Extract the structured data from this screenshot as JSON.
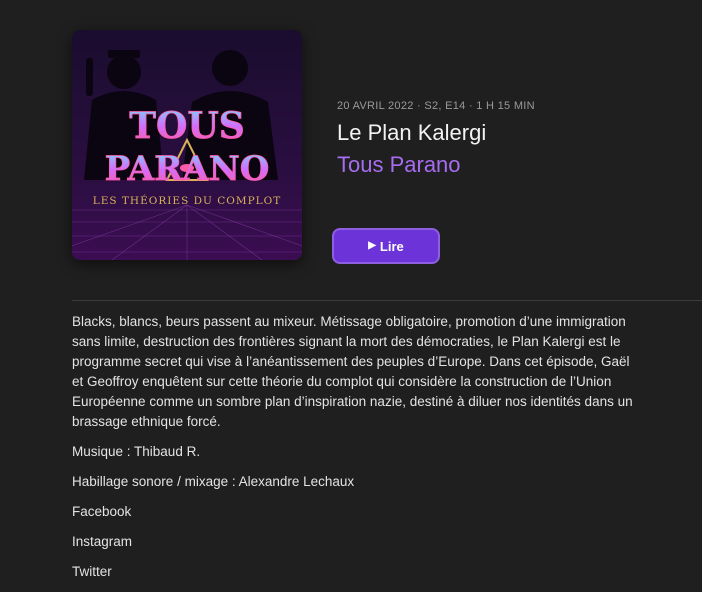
{
  "artwork": {
    "show_name_line1": "TOUS",
    "show_name_line2": "PARANO",
    "tagline": "LES THÉORIES DU COMPLOT",
    "colors": {
      "background_top": "#1a0d2e",
      "background_bottom": "#3b0d52",
      "title_pink": "#ff5aa5",
      "title_cyan": "#6fe3ff",
      "tagline_gold": "#d9b15a"
    }
  },
  "episode": {
    "meta": "20 AVRIL 2022 · S2, E14 · 1 H 15 MIN",
    "title": "Le Plan Kalergi",
    "show": "Tous Parano"
  },
  "play_button": {
    "label": "Lire",
    "icon": "play-icon"
  },
  "description": {
    "summary": "Blacks, blancs, beurs passent au mixeur. Métissage obligatoire, promotion d’une immigration sans limite, destruction des frontières signant la mort des démocraties, le Plan Kalergi est le programme secret qui vise à l’anéantissement des peuples d’Europe. Dans cet épisode, Gaël et Geoffroy enquêtent sur cette théorie du complot qui considère la construction de l’Union Européenne comme un sombre plan d’inspiration nazie, destiné à diluer nos identités dans un brassage ethnique forcé.",
    "music": "Musique : Thibaud R.",
    "mixing": "Habillage sonore / mixage : Alexandre Lechaux",
    "link1": "Facebook",
    "link2": "Instagram",
    "link3": "Twitter"
  },
  "colors": {
    "accent": "#a76cf0",
    "button": "#6b33d8",
    "background": "#1f1f1f"
  }
}
